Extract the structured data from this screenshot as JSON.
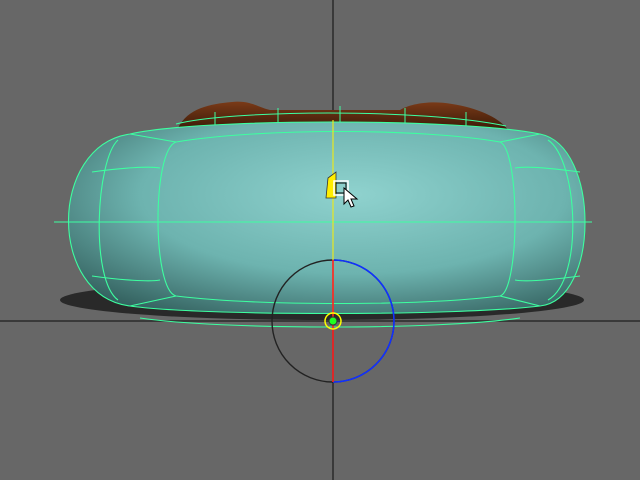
{
  "viewport": {
    "view": "front",
    "background_color": "#676767",
    "grid_axis_color": "#2a2a2a"
  },
  "object": {
    "kind": "rounded pillow / capsule mesh",
    "surface_color": "#6fb8b4",
    "wireframe_color": "#3dffa0",
    "top_detail_color": "#5a2a12"
  },
  "manipulator": {
    "tool": "rotate",
    "x_axis_color": "#ff2020",
    "y_axis_color": "#20ff20",
    "z_axis_color": "#1030ff",
    "pivot_color": "#ffff00"
  },
  "cursor": {
    "icon": "arrow-cursor-icon"
  }
}
